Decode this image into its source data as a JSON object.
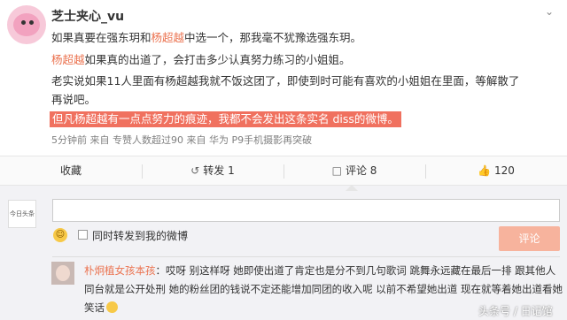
{
  "post": {
    "username": "芝士夹心_vu",
    "more_icon": "chevron-down-icon",
    "line1": {
      "pre": "如果真要在强东玥和",
      "mention": "杨超越",
      "post": "中选一个，那我毫不犹豫选强东玥。"
    },
    "line2": {
      "mention": "杨超越",
      "post": "如果真的出道了，会打击多少认真努力练习的小姐姐。"
    },
    "line3a": "老实说如果11人里面有杨超越我就不饭这团了，即使到时可能有喜欢的小姐姐在里面，等解散了",
    "line3b": "再说吧。",
    "line4": "但凡杨超越有一点点努力的痕迹，我都不会发出这条实名 diss的微博。",
    "meta": "5分钟前 来自 专赞人数超过90 来自 华为 P9手机摄影再突破"
  },
  "actions": {
    "favorite": "收藏",
    "repost": "转发 1",
    "comment": "评论 8",
    "like": "120",
    "repost_icon": "repost-icon",
    "comment_icon": "comment-icon",
    "like_icon": "thumbs-up-icon"
  },
  "composer": {
    "avatar_text": "今日头条",
    "input_value": "",
    "emoji_icon": "smiley-icon",
    "checkbox_label": "同时转发到我的微博",
    "submit": "评论"
  },
  "comment": {
    "user": "朴炯植女孩本孩",
    "text1": "：哎呀 别这样呀 她即使出道了肯定也是分不到几句歌词 跳舞永远藏在最后一排 跟其他人",
    "text2": "同台就是公开处刑 她的粉丝团的钱说不定还能增加同团的收入呢 以前不希望她出道 现在就等着她出道看她",
    "text3": "笑话"
  },
  "watermark": "头条号 / 日记馆",
  "colors": {
    "accent": "#eb7350",
    "highlight": "#f0715f",
    "button": "#f7b39d"
  }
}
